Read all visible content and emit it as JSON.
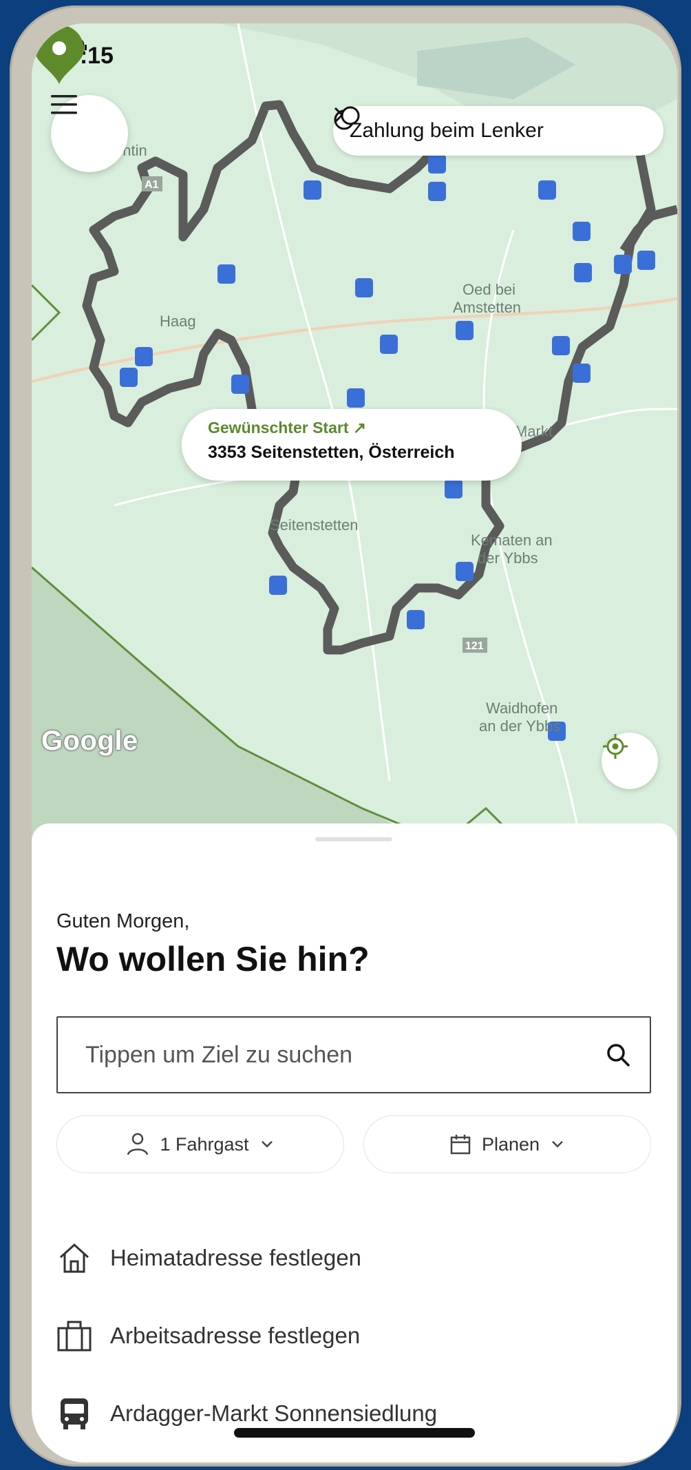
{
  "status_bar": {
    "time": "08:15"
  },
  "map": {
    "payment_pill": "Zahlung beim Lenker",
    "start_bubble": {
      "label": "Gewünschter Start ↗",
      "address": "3353 Seitenstetten, Österreich"
    },
    "place_labels": [
      "entin",
      "Haag",
      "Oed bei",
      "Amstetten",
      "Markt",
      "Seitenstetten",
      "Kematen an",
      "der Ybbs",
      "Waidhofen",
      "an der Ybbs",
      "A1",
      "121"
    ],
    "attribution": "Google",
    "colors": {
      "zone_fill": "#d9eedc",
      "boundary": "#5b5b5b",
      "pin": "#5f8a2b",
      "bus_stop": "#3b6fd8"
    }
  },
  "sheet": {
    "greeting": "Guten Morgen,",
    "title": "Wo wollen Sie hin?",
    "search": {
      "placeholder": "Tippen um Ziel zu suchen"
    },
    "chips": {
      "passengers": "1 Fahrgast",
      "schedule": "Planen"
    },
    "items": [
      {
        "icon": "home-icon",
        "label": "Heimatadresse festlegen"
      },
      {
        "icon": "briefcase-icon",
        "label": "Arbeitsadresse festlegen"
      },
      {
        "icon": "bus-icon",
        "label": "Ardagger-Markt Sonnensiedlung"
      }
    ]
  }
}
